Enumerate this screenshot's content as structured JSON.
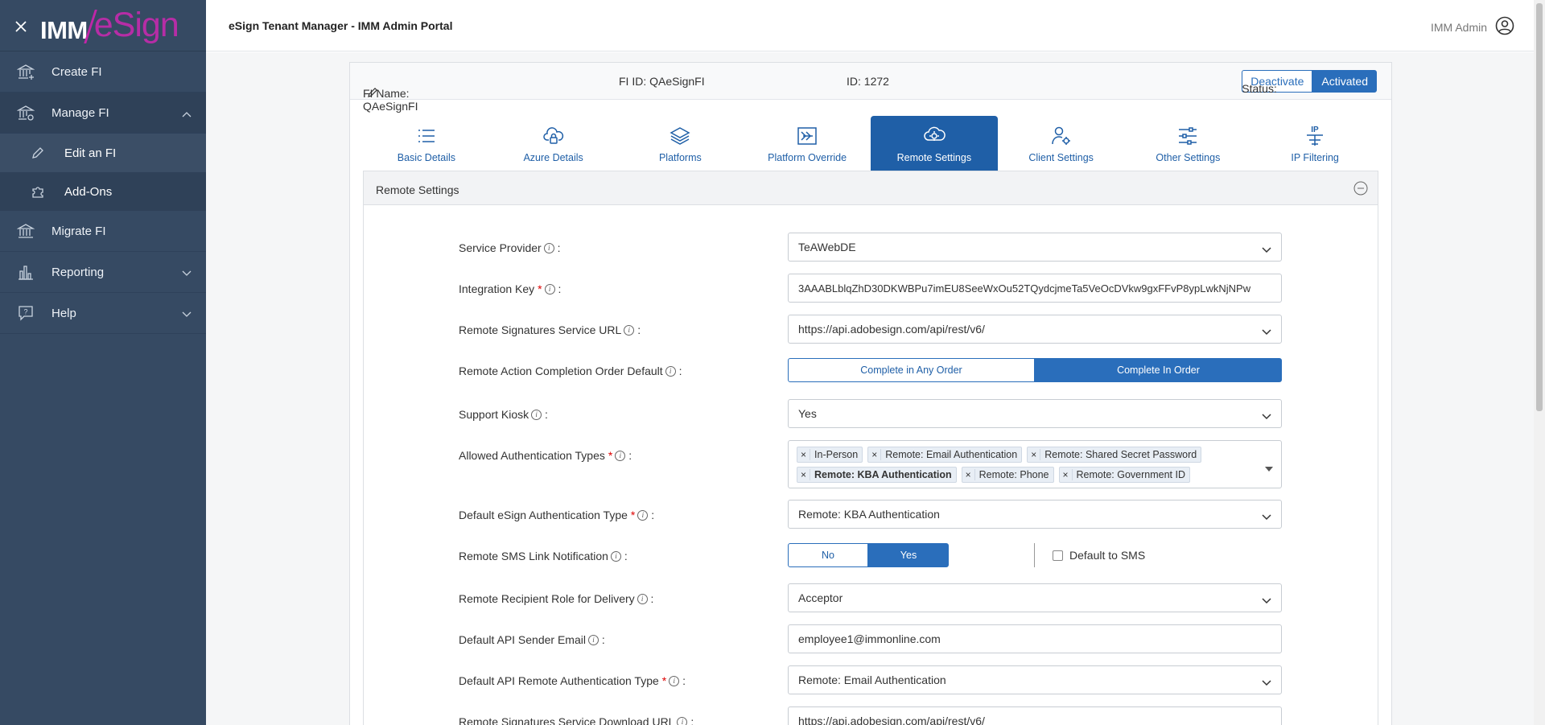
{
  "sidebar": {
    "close_icon": "close-icon",
    "logo_imm": "IMM",
    "logo_esign": "eSign",
    "items": [
      {
        "label": "Create FI",
        "icon": "bank-plus-icon"
      },
      {
        "label": "Manage FI",
        "icon": "bank-gear-icon"
      },
      {
        "label": "Migrate FI",
        "icon": "bank-arrow-icon"
      },
      {
        "label": "Reporting",
        "icon": "bar-chart-icon"
      },
      {
        "label": "Help",
        "icon": "help-bubble-icon"
      }
    ],
    "sub_items": [
      {
        "label": "Edit an FI",
        "icon": "pencil-icon"
      },
      {
        "label": "Add-Ons",
        "icon": "puzzle-icon"
      }
    ]
  },
  "topbar": {
    "title": "eSign Tenant Manager - IMM Admin Portal",
    "user_name": "IMM Admin"
  },
  "fi": {
    "name_label": "FI Name: QAeSignFI",
    "id_label": "FI ID: QAeSignFI",
    "num_id_label": "ID: 1272",
    "status_label": "Status:",
    "deactivate_label": "Deactivate",
    "activated_label": "Activated"
  },
  "tabs": [
    {
      "label": "Basic Details",
      "icon": "list-icon"
    },
    {
      "label": "Azure Details",
      "icon": "cloud-lock-icon"
    },
    {
      "label": "Platforms",
      "icon": "layers-icon"
    },
    {
      "label": "Platform Override",
      "icon": "override-icon"
    },
    {
      "label": "Remote Settings",
      "icon": "gear-cloud-icon",
      "active": true
    },
    {
      "label": "Client Settings",
      "icon": "user-gear-icon"
    },
    {
      "label": "Other Settings",
      "icon": "sliders-icon"
    },
    {
      "label": "IP Filtering",
      "icon": "ip-icon"
    }
  ],
  "section": {
    "title": "Remote Settings"
  },
  "form": {
    "service_provider": {
      "label": "Service Provider",
      "value": "TeAWebDE"
    },
    "integration_key": {
      "label": "Integration Key",
      "value": "3AAABLblqZhD30DKWBPu7imEU8SeeWxOu52TQydcjmeTa5VeOcDVkw9gxFFvP8ypLwkNjNPw"
    },
    "remote_sig_url": {
      "label": "Remote Signatures Service URL",
      "value": "https://api.adobesign.com/api/rest/v6/"
    },
    "completion_order": {
      "label": "Remote Action Completion Order Default",
      "opt_any": "Complete in Any Order",
      "opt_order": "Complete In Order",
      "selected": "Complete In Order"
    },
    "support_kiosk": {
      "label": "Support Kiosk",
      "value": "Yes"
    },
    "auth_types": {
      "label": "Allowed Authentication Types",
      "tags_line1": [
        "In-Person",
        "Remote: Email Authentication",
        "Remote: Shared Secret Password"
      ],
      "tags_line2": [
        "Remote: KBA Authentication",
        "Remote: Phone",
        "Remote: Government ID"
      ]
    },
    "default_auth": {
      "label": "Default eSign Authentication Type",
      "value": "Remote: KBA Authentication"
    },
    "sms_notify": {
      "label": "Remote SMS Link Notification",
      "opt_no": "No",
      "opt_yes": "Yes",
      "selected": "Yes",
      "default_sms_label": "Default to SMS",
      "default_sms_checked": false
    },
    "recipient_role": {
      "label": "Remote Recipient Role for Delivery",
      "value": "Acceptor"
    },
    "api_sender_email": {
      "label": "Default API Sender Email",
      "value": "employee1@immonline.com"
    },
    "api_remote_auth": {
      "label": "Default API Remote Authentication Type",
      "value": "Remote: Email Authentication"
    },
    "download_url": {
      "label": "Remote Signatures Service Download URL",
      "value": "https://api.adobesign.com/api/rest/v6/"
    }
  },
  "colors": {
    "sidebar": "#364a63",
    "accent": "#2a6ebb",
    "brand": "#b62da6"
  }
}
